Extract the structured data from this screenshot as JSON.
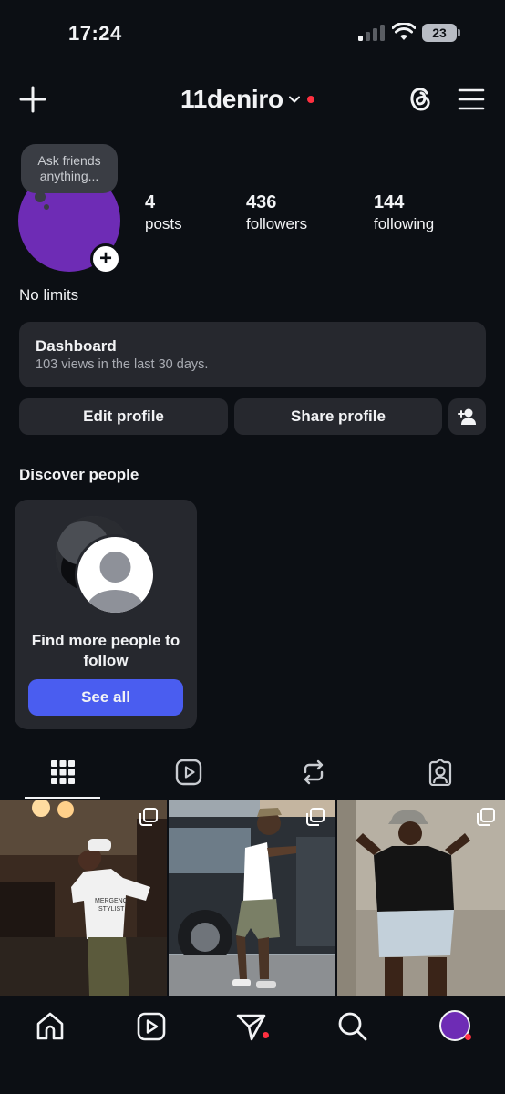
{
  "status_bar": {
    "time": "17:24",
    "battery": "23"
  },
  "header": {
    "username": "11deniro"
  },
  "profile": {
    "note": "Ask friends anything...",
    "stats": [
      {
        "value": "4",
        "label": "posts"
      },
      {
        "value": "436",
        "label": "followers"
      },
      {
        "value": "144",
        "label": "following"
      }
    ],
    "bio": "No limits"
  },
  "dashboard": {
    "title": "Dashboard",
    "subtitle": "103 views in the last 30 days."
  },
  "actions": {
    "edit_profile": "Edit profile",
    "share_profile": "Share profile"
  },
  "discover": {
    "title": "Discover people",
    "card_text": "Find more people to follow",
    "button": "See all"
  },
  "posts": [
    {
      "shirt_text": "MERGENC STYLIST"
    },
    {},
    {}
  ],
  "colors": {
    "avatar": "#6e2cb5",
    "accent": "#4a5df0",
    "notification": "#ff3040"
  }
}
